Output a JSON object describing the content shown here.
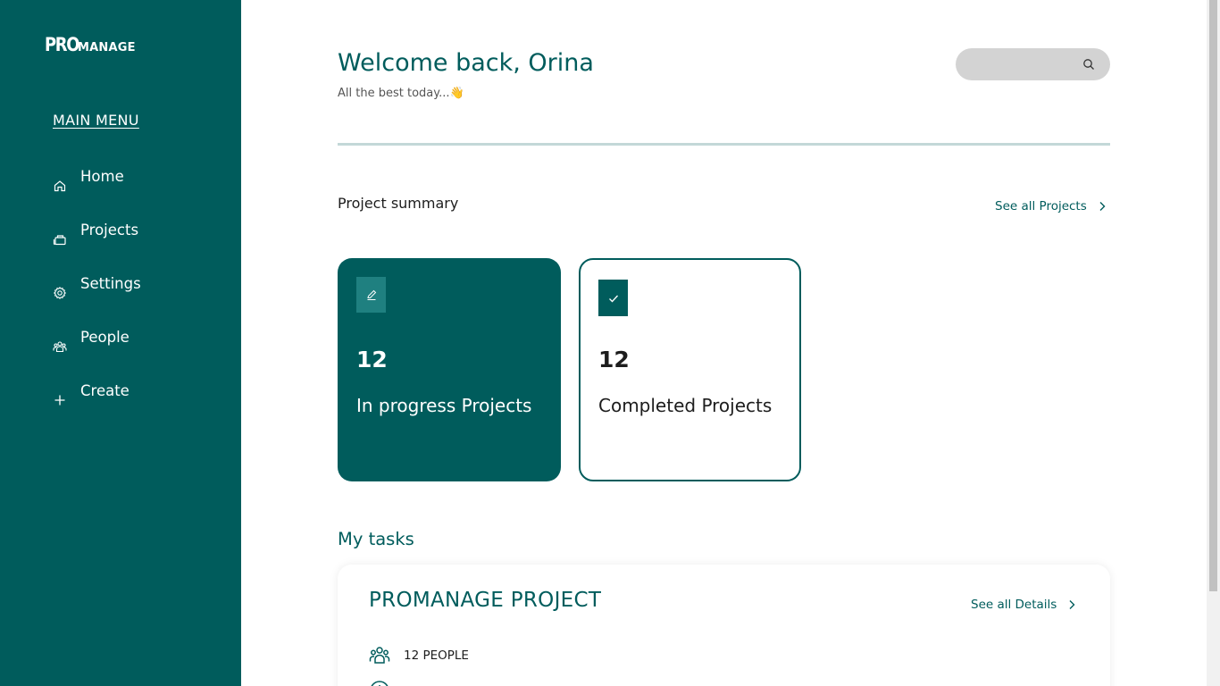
{
  "sidebar": {
    "logo_pro": "PRO",
    "logo_manage": "MANAGE",
    "main_menu": "MAIN MENU",
    "items": [
      {
        "label": "Home",
        "icon": "home-icon"
      },
      {
        "label": "Projects",
        "icon": "briefcase-icon"
      },
      {
        "label": "Settings",
        "icon": "gear-icon"
      },
      {
        "label": "People",
        "icon": "people-icon"
      },
      {
        "label": "Create",
        "icon": "plus-icon"
      }
    ]
  },
  "header": {
    "welcome": "Welcome back, Orina",
    "subtitle": "All the best today...👋",
    "search_placeholder": ""
  },
  "summary": {
    "title": "Project summary",
    "see_all": "See all Projects",
    "cards": [
      {
        "count": "12",
        "label": "In progress Projects",
        "icon": "edit-icon"
      },
      {
        "count": "12",
        "label": "Completed Projects",
        "icon": "check-icon"
      }
    ]
  },
  "tasks": {
    "title": "My tasks",
    "project_title": "PROMANAGE PROJECT",
    "see_details": "See all Details",
    "people": "12 PEOPLE"
  },
  "colors": {
    "primary": "#005c5c",
    "accent": "#1f8080",
    "divider": "#c3d8d8",
    "search_bg": "#d3d3d3"
  }
}
